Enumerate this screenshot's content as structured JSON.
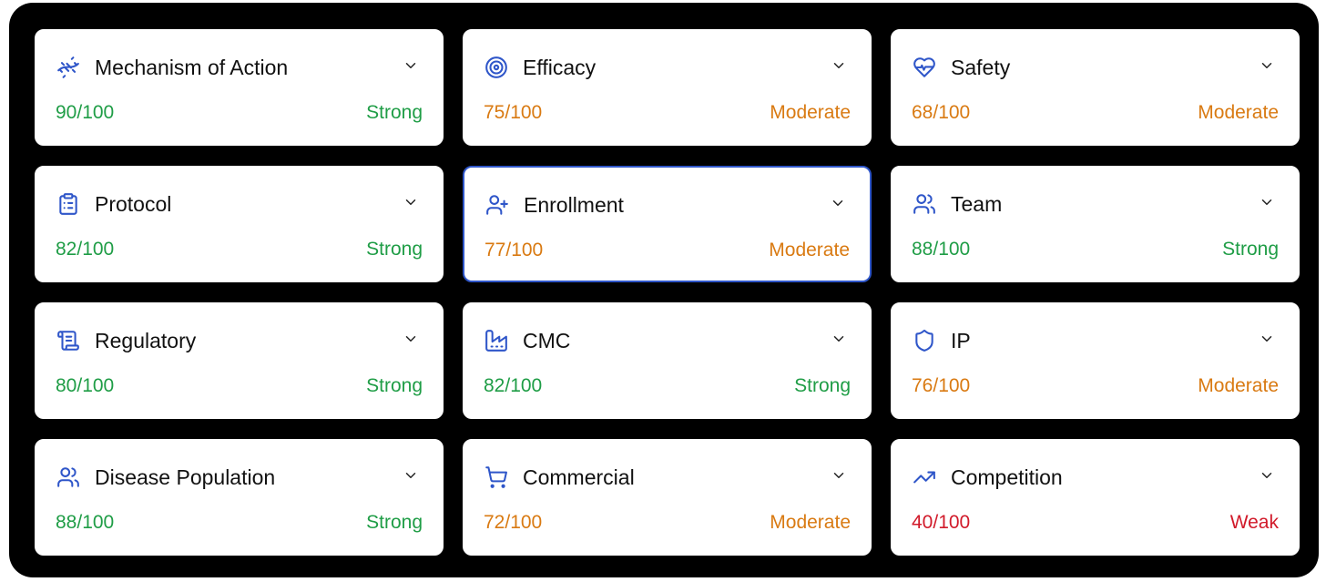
{
  "colors": {
    "accent": "#2f56c9",
    "strong": "#1f9d46",
    "moderate": "#d97a12",
    "weak": "#d11a2a"
  },
  "cards": [
    {
      "title": "Mechanism of Action",
      "icon": "dna-icon",
      "score": "90/100",
      "rating": "Strong"
    },
    {
      "title": "Efficacy",
      "icon": "target-icon",
      "score": "75/100",
      "rating": "Moderate"
    },
    {
      "title": "Safety",
      "icon": "heart-pulse-icon",
      "score": "68/100",
      "rating": "Moderate"
    },
    {
      "title": "Protocol",
      "icon": "clipboard-list-icon",
      "score": "82/100",
      "rating": "Strong"
    },
    {
      "title": "Enrollment",
      "icon": "user-plus-icon",
      "score": "77/100",
      "rating": "Moderate",
      "selected": true
    },
    {
      "title": "Team",
      "icon": "users-icon",
      "score": "88/100",
      "rating": "Strong"
    },
    {
      "title": "Regulatory",
      "icon": "scroll-icon",
      "score": "80/100",
      "rating": "Strong"
    },
    {
      "title": "CMC",
      "icon": "factory-icon",
      "score": "82/100",
      "rating": "Strong"
    },
    {
      "title": "IP",
      "icon": "shield-icon",
      "score": "76/100",
      "rating": "Moderate"
    },
    {
      "title": "Disease Population",
      "icon": "users-icon",
      "score": "88/100",
      "rating": "Strong"
    },
    {
      "title": "Commercial",
      "icon": "shopping-cart-icon",
      "score": "72/100",
      "rating": "Moderate"
    },
    {
      "title": "Competition",
      "icon": "trending-up-icon",
      "score": "40/100",
      "rating": "Weak"
    }
  ]
}
